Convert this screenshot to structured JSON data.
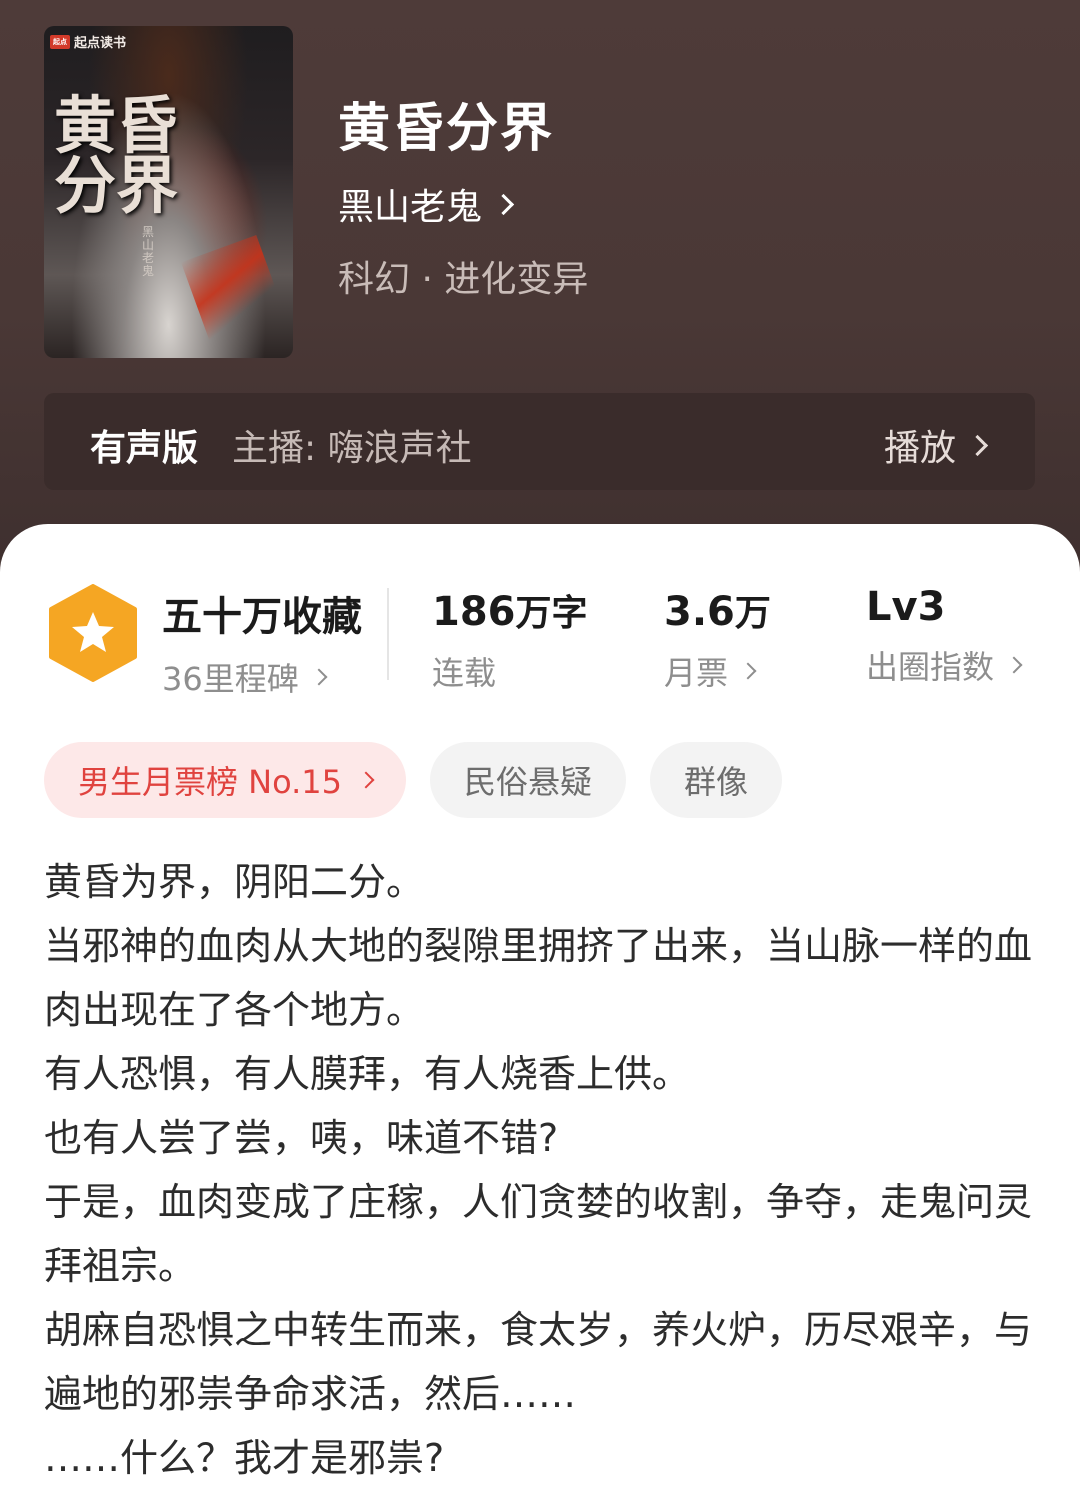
{
  "book": {
    "cover_brand": "起点读书",
    "cover_title": "黄昏分界",
    "cover_author": "黑山老鬼",
    "title": "黄昏分界",
    "author": "黑山老鬼",
    "genre": "科幻 · 进化变异"
  },
  "audio": {
    "label": "有声版",
    "host": "主播: 嗨浪声社",
    "play_label": "播放"
  },
  "stats": {
    "favorites": "五十万收藏",
    "milestones": "36里程碑",
    "word_count_num": "186",
    "word_count_unit": "万字",
    "status": "连载",
    "monthly_votes_num": "3.6",
    "monthly_votes_unit": "万",
    "monthly_votes_label": "月票",
    "level": "Lv3",
    "level_label": "出圈指数"
  },
  "tags": [
    "男生月票榜 No.15",
    "民俗悬疑",
    "群像"
  ],
  "synopsis": [
    "黄昏为界，阴阳二分。",
    "当邪神的血肉从大地的裂隙里拥挤了出来，当山脉一样的血肉出现在了各个地方。",
    "有人恐惧，有人膜拜，有人烧香上供。",
    "也有人尝了尝，咦，味道不错?",
    "于是，血肉变成了庄稼，人们贪婪的收割，争夺，走鬼问灵拜祖宗。",
    "胡麻自恐惧之中转生而来，食太岁，养火炉，历尽艰辛，与遍地的邪祟争命求活，然后……",
    "……什么？我才是邪祟?"
  ],
  "colors": {
    "hero_bg": "#4a3836",
    "badge_orange": "#f5a623",
    "hot_tag_text": "#e0433f",
    "hot_tag_bg": "#fde8e8"
  }
}
